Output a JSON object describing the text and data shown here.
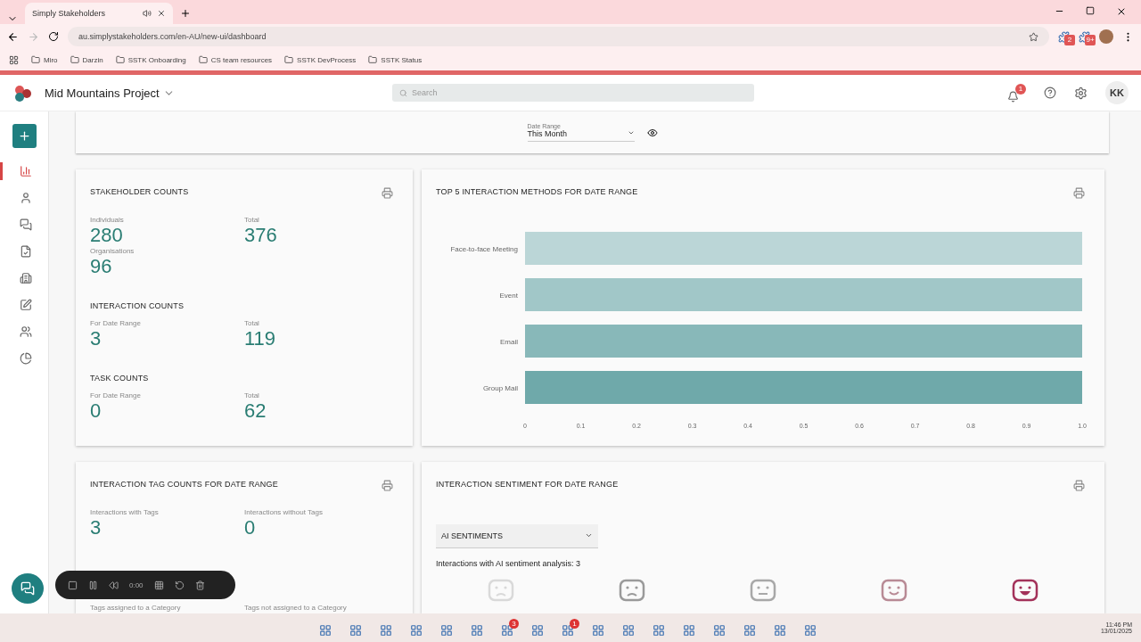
{
  "browser": {
    "tabs": [
      {
        "title": "Simply Stakeholders",
        "selected": true
      }
    ],
    "url": "au.simplystakeholders.com/en-AU/new-ui/dashboard",
    "bookmarks": [
      "Miro",
      "Darzin",
      "SSTK Onboarding",
      "CS team resources",
      "SSTK DevProcess",
      "SSTK Status"
    ],
    "extension_badges": [
      "2",
      "9+"
    ]
  },
  "header": {
    "project": "Mid Mountains Project",
    "search": {
      "placeholder": "Search"
    },
    "notifications": "1",
    "avatar": "KK"
  },
  "sidebar": {
    "items": [
      {
        "selected": true
      },
      {
        "selected": false
      },
      {
        "selected": false
      },
      {
        "selected": false
      },
      {
        "selected": false
      },
      {
        "selected": false
      },
      {
        "selected": false
      },
      {
        "selected": false
      }
    ]
  },
  "filter": {
    "label": "Date Range",
    "value": "This Month"
  },
  "stakeholder_counts": {
    "title": "STAKEHOLDER COUNTS",
    "stats": [
      {
        "label": "Individuals",
        "value": "280"
      },
      {
        "label": "Total",
        "value": "376"
      },
      {
        "label": "Organisations",
        "value": "96"
      }
    ]
  },
  "interaction_counts": {
    "title": "INTERACTION COUNTS",
    "stats": [
      {
        "label": "For Date Range",
        "value": "3"
      },
      {
        "label": "Total",
        "value": "119"
      }
    ]
  },
  "task_counts": {
    "title": "TASK COUNTS",
    "stats": [
      {
        "label": "For Date Range",
        "value": "0"
      },
      {
        "label": "Total",
        "value": "62"
      }
    ]
  },
  "methods": {
    "title": "TOP 5 INTERACTION METHODS FOR DATE RANGE",
    "chart_data": {
      "type": "bar",
      "orientation": "horizontal",
      "categories": [
        "Face-to-face Meeting",
        "Event",
        "Email",
        "Group Mail"
      ],
      "series": [
        {
          "color": "#6fa9aa",
          "values": [
            1,
            1,
            1,
            1
          ]
        }
      ],
      "xlim": [
        0,
        1
      ],
      "xticks": [
        0,
        0.1,
        0.2,
        0.3,
        0.4,
        0.5,
        0.6,
        0.7,
        0.8,
        0.9,
        {
          "value": 1,
          "label": "1.0"
        }
      ]
    }
  },
  "tag_counts": {
    "title": "INTERACTION TAG COUNTS FOR DATE RANGE",
    "stats": [
      {
        "label": "Interactions with Tags",
        "value": "3"
      },
      {
        "label": "Interactions without Tags",
        "value": "0"
      }
    ],
    "footer": [
      "Tags assigned to a Category",
      "Tags not assigned to a Category"
    ]
  },
  "sentiment": {
    "title": "INTERACTION SENTIMENT FOR DATE RANGE",
    "select": "AI SENTIMENTS",
    "summary": "Interactions with AI sentiment analysis: 3",
    "faces": [
      {
        "color": "#d9d9d9"
      },
      {
        "color": "#9a9a9a"
      },
      {
        "color": "#a8a8a8"
      },
      {
        "color": "#b88a95"
      },
      {
        "color": "#a3325a"
      }
    ]
  },
  "recorder": {
    "time": "0:00"
  },
  "taskbar": {
    "time": "11:46 PM",
    "date": "13/01/2025",
    "badges": [
      "3",
      "1"
    ]
  }
}
